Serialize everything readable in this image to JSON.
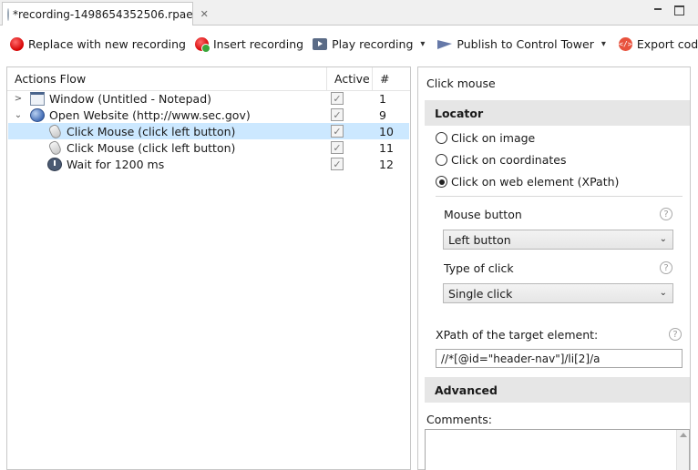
{
  "tab": {
    "title": "*recording-1498654352506.rpae",
    "close_glyph": "✕"
  },
  "toolbar": {
    "replace_label": "Replace with new recording",
    "insert_label": "Insert recording",
    "play_label": "Play recording",
    "publish_label": "Publish to Control Tower",
    "export_label": "Export code",
    "export_icon_text": "</>",
    "dropdown_glyph": "▾"
  },
  "actions_table": {
    "columns": {
      "flow": "Actions Flow",
      "active": "Active",
      "number": "#"
    },
    "rows": [
      {
        "label": "Window (Untitled - Notepad)",
        "number": "1",
        "icon": "window-icon",
        "twist": ">",
        "active": true,
        "selected": false
      },
      {
        "label": "Open Website (http://www.sec.gov)",
        "number": "9",
        "icon": "globe-icon",
        "twist": "⌄",
        "active": true,
        "selected": false
      },
      {
        "label": "Click Mouse (click left button)",
        "number": "10",
        "icon": "mouse-icon",
        "twist": "",
        "active": true,
        "selected": true
      },
      {
        "label": "Click Mouse (click left button)",
        "number": "11",
        "icon": "mouse-icon",
        "twist": "",
        "active": true,
        "selected": false
      },
      {
        "label": "Wait for 1200 ms",
        "number": "12",
        "icon": "clock-icon",
        "twist": "",
        "active": true,
        "selected": false
      }
    ]
  },
  "details": {
    "title": "Click mouse",
    "locator_heading": "Locator",
    "locator_options": [
      {
        "label": "Click on image",
        "selected": false
      },
      {
        "label": "Click on coordinates",
        "selected": false
      },
      {
        "label": "Click on web element (XPath)",
        "selected": true
      }
    ],
    "mouse_button_label": "Mouse button",
    "mouse_button_value": "Left button",
    "type_of_click_label": "Type of click",
    "type_of_click_value": "Single click",
    "xpath_label": "XPath of the target element:",
    "xpath_value": "//*[@id=\"header-nav\"]/li[2]/a",
    "advanced_heading": "Advanced",
    "comments_label": "Comments:",
    "help_glyph": "?",
    "select_arrow_glyph": "⌄",
    "check_glyph": "✓"
  }
}
